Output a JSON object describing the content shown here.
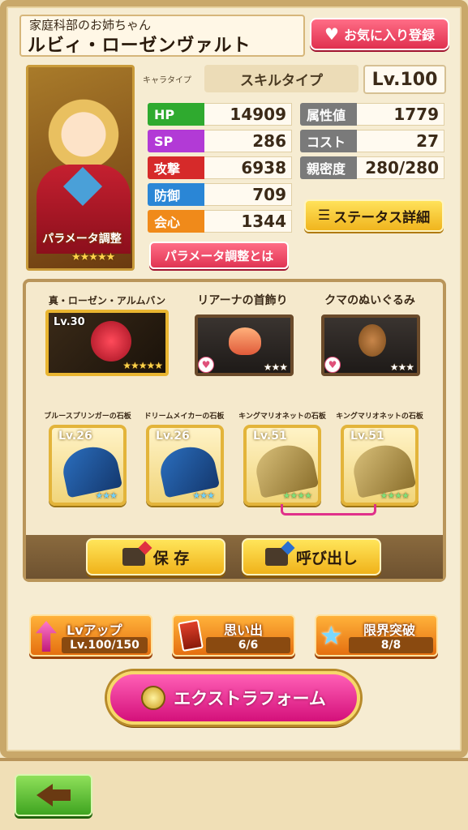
{
  "header": {
    "subtitle": "家庭科部のお姉ちゃん",
    "name": "ルビィ・ローゼンヴァルト",
    "favorite_button": "お気に入り登録"
  },
  "portrait": {
    "param_label": "パラメータ調整",
    "stars": "★★★★★"
  },
  "chara_type": {
    "label": "キャラタイプ",
    "value": "スキルタイプ",
    "level": "Lv.100"
  },
  "stats_left": [
    {
      "label": "HP",
      "value": "14909",
      "color": "#2faa2f"
    },
    {
      "label": "SP",
      "value": "286",
      "color": "#b23ad6"
    },
    {
      "label": "攻撃",
      "value": "6938",
      "color": "#d62a2a"
    },
    {
      "label": "防御",
      "value": "709",
      "color": "#2a86d6"
    },
    {
      "label": "会心",
      "value": "1344",
      "color": "#f08a1a"
    }
  ],
  "stats_right": [
    {
      "label": "属性値",
      "value": "1779",
      "color": "#7a7a7a"
    },
    {
      "label": "コスト",
      "value": "27",
      "color": "#7a7a7a"
    },
    {
      "label": "親密度",
      "value": "280/280",
      "color": "#7a7a7a"
    }
  ],
  "buttons": {
    "param_adjust": "パラメータ調整とは",
    "status_detail": "ステータス詳細",
    "save": "保 存",
    "load": "呼び出し",
    "extra_form": "エクストラフォーム"
  },
  "equipment": [
    {
      "title": "真・ローゼン・アルムバント",
      "level": "Lv.30",
      "stars": "★★★★★"
    },
    {
      "title": "リアーナの首飾り",
      "stars": "★★★"
    },
    {
      "title": "クマのぬいぐるみ",
      "stars": "★★★"
    }
  ],
  "slates": [
    {
      "title": "ブルースプリンガーの石板",
      "level": "Lv.26",
      "stars": "★★★"
    },
    {
      "title": "ドリームメイカーの石板",
      "level": "Lv.26",
      "stars": "★★★"
    },
    {
      "title": "キングマリオネットの石板",
      "level": "Lv.51",
      "stars": "★★★★"
    },
    {
      "title": "キングマリオネットの石板",
      "level": "Lv.51",
      "stars": "★★★★"
    }
  ],
  "bottom_buttons": [
    {
      "label": "Lvアップ",
      "value": "Lv.100/150"
    },
    {
      "label": "思い出",
      "value": "6/6"
    },
    {
      "label": "限界突破",
      "value": "8/8"
    }
  ]
}
